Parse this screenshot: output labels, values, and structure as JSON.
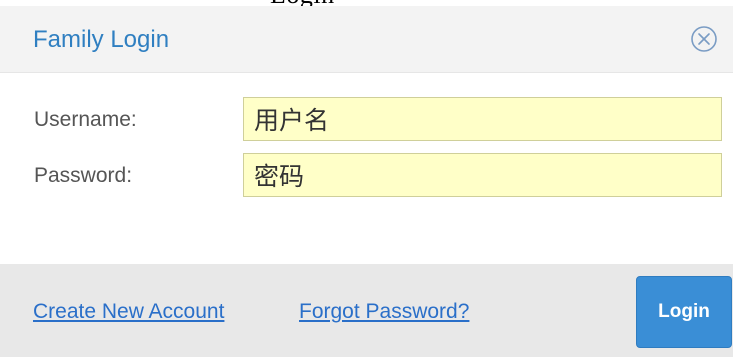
{
  "dialog": {
    "title": "Family Login",
    "close_icon": "close-circle-icon"
  },
  "form": {
    "username_label": "Username:",
    "username_value": "用户名",
    "password_label": "Password:",
    "password_value": "密码"
  },
  "footer": {
    "create_account_link": "Create New Account",
    "forgot_password_link": "Forgot Password?",
    "login_button": "Login"
  },
  "colors": {
    "title": "#2f7fc1",
    "header_background": "#f3f3f3",
    "input_background": "#ffffc8",
    "footer_background": "#e8e8e8",
    "login_button": "#3a8ed6",
    "link": "#2a6fc9"
  }
}
